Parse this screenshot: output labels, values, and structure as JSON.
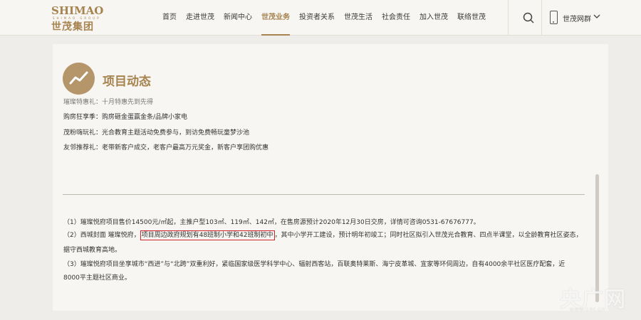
{
  "header": {
    "logo_en": "SHIMAO",
    "logo_sub": "SHIMAO GROUP",
    "logo_cn": "世茂集团",
    "nav": [
      {
        "label": "首页",
        "active": false
      },
      {
        "label": "走进世茂",
        "active": false
      },
      {
        "label": "新闻中心",
        "active": false
      },
      {
        "label": "世茂业务",
        "active": true
      },
      {
        "label": "投资者关系",
        "active": false
      },
      {
        "label": "世茂生活",
        "active": false
      },
      {
        "label": "社会责任",
        "active": false
      },
      {
        "label": "加入世茂",
        "active": false
      },
      {
        "label": "联络世茂",
        "active": false
      }
    ],
    "mobile_label": "世茂网群",
    "accent_color": "#a6834f"
  },
  "section": {
    "title": "项目动态",
    "icon": "trend-line-icon"
  },
  "promos": [
    "璀璨特惠礼：十月特惠先到先得",
    "购房狂享季：购房砸金蛋赢金条/品牌小家电",
    "茂粉嗨玩礼：光合教育主题活动免费参与，到访免费畅玩童梦沙池",
    "友邻推荐礼：老带新客户成交，老客户最高万元奖金，新客户享团购优惠"
  ],
  "notes": {
    "n1": "（1）璀璨悦府项目售价14500元/㎡起，主推户型103㎡、119㎡、142㎡，在售房源预计2020年12月30日交房，详情可咨询0531-67676777。",
    "n2_prefix": "（2）西城封面 璀璨悦府，",
    "n2_highlight": "项目周边政府规划有48班制小学和42班制初中",
    "n2_suffix": "，其中小学开工建设，预计明年初竣工；同时社区拟引入世茂光合教育、四点半课堂，以全龄教育社区姿态，",
    "n2_line2": "据守西城教育高地。",
    "n3_line1": "（3）璀璨悦府项目坐享城市“西进”与“北跨”双重利好，紧临国家级医学科学中心、辐射西客站，百联奥特莱斯、海宁皮革城、宜家等环伺周边，自有4000余平社区医疗配套，近",
    "n3_line2": "8000平主题社区商业。"
  },
  "highlight_color": "#d3232a",
  "watermark": {
    "text": "央广网",
    "url": "www.cnr.cn"
  }
}
